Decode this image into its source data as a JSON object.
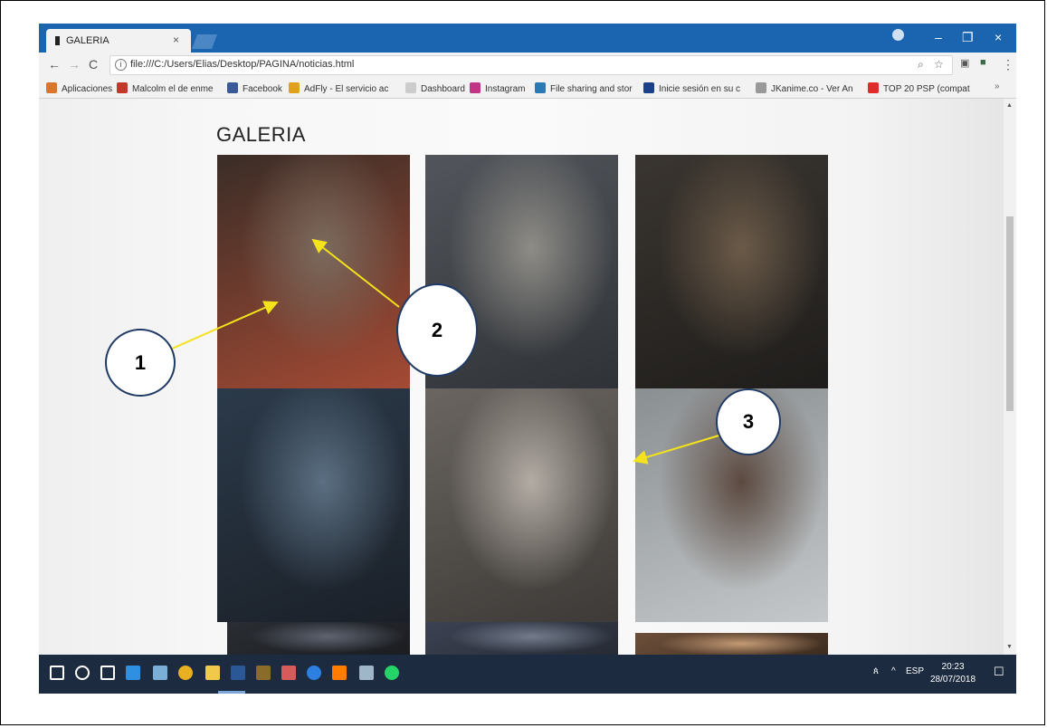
{
  "browser": {
    "tab_title": "GALERIA",
    "tab_close": "×",
    "url": "file:///C:/Users/Elias/Desktop/PAGINA/noticias.html",
    "window_controls": [
      "–",
      "❐",
      "×"
    ],
    "icons": {
      "back": "back-arrow-icon",
      "forward": "forward-arrow-icon",
      "reload": "reload-icon",
      "zoom": "magnifier-icon",
      "star": "bookmark-star-icon",
      "menu": "kebab-menu-icon"
    }
  },
  "bookmarks": [
    {
      "label": "Aplicaciones",
      "color": "#d9762b"
    },
    {
      "label": "Malcolm el de enme",
      "color": "#c0392b"
    },
    {
      "label": "Facebook",
      "color": "#3b5998"
    },
    {
      "label": "AdFly - El servicio ac",
      "color": "#e0a020"
    },
    {
      "label": "Dashboard",
      "color": "#cccccc"
    },
    {
      "label": "Instagram",
      "color": "#c13584"
    },
    {
      "label": "File sharing and stor",
      "color": "#2a7ab8"
    },
    {
      "label": "Inicie sesión en su c",
      "color": "#1b3f8b"
    },
    {
      "label": "JKanime.co - Ver An",
      "color": "#999999"
    },
    {
      "label": "TOP 20 PSP (compat",
      "color": "#e02b2b"
    }
  ],
  "bookmarks_more": "»",
  "page": {
    "title": "GALERIA"
  },
  "gallery": [
    {
      "name": "gym-photo-group-training",
      "colors": [
        "#3a2d27",
        "#7b6b5e",
        "#a44a34"
      ]
    },
    {
      "name": "gym-photo-men-curls",
      "colors": [
        "#52565c",
        "#8e8c86",
        "#2f3236"
      ]
    },
    {
      "name": "gym-photo-medicine-ball",
      "colors": [
        "#3a3530",
        "#6b5a48",
        "#1f1d1b"
      ]
    },
    {
      "name": "gym-photo-man-dumbbell",
      "colors": [
        "#2b3a4a",
        "#5b6f82",
        "#1b2028"
      ]
    },
    {
      "name": "gym-photo-woman-situps",
      "colors": [
        "#6a6560",
        "#b3aca5",
        "#3d3a37"
      ]
    },
    {
      "name": "gym-photo-man-cage",
      "colors": [
        "#8a8f92",
        "#5c4a40",
        "#c4c8ca"
      ]
    },
    {
      "name": "gym-photo-row3-left",
      "colors": [
        "#2a2d33",
        "#5e6470",
        "#1a1c20"
      ]
    },
    {
      "name": "gym-photo-row3-middle",
      "colors": [
        "#3c4252",
        "#747c8c",
        "#252a34"
      ]
    },
    {
      "name": "gym-photo-row3-right",
      "colors": [
        "#6c4f3a",
        "#c49a74",
        "#3a2a1e"
      ]
    }
  ],
  "annotations": [
    {
      "label": "1"
    },
    {
      "label": "2"
    },
    {
      "label": "3"
    }
  ],
  "taskbar": {
    "apps": [
      {
        "name": "windows-start-icon",
        "color": "#ffffff"
      },
      {
        "name": "cortana-icon",
        "color": "#ffffff"
      },
      {
        "name": "task-view-icon",
        "color": "#ffffff"
      },
      {
        "name": "edge-icon",
        "color": "#2f8fe0"
      },
      {
        "name": "generic-app-icon",
        "color": "#7ab0d8"
      },
      {
        "name": "chrome-icon",
        "color": "#e8b020"
      },
      {
        "name": "file-explorer-icon",
        "color": "#f2c84b"
      },
      {
        "name": "word-icon",
        "color": "#2b5797"
      },
      {
        "name": "app-icon",
        "color": "#8a6b2a"
      },
      {
        "name": "paint-icon",
        "color": "#d85a5a"
      },
      {
        "name": "messages-icon",
        "color": "#2d7fe0"
      },
      {
        "name": "illustrator-icon",
        "color": "#ff7c00"
      },
      {
        "name": "wrench-icon",
        "color": "#9fb5c8"
      },
      {
        "name": "whatsapp-icon",
        "color": "#25d366"
      }
    ],
    "language": "ESP",
    "time": "20:23",
    "date": "28/07/2018"
  }
}
